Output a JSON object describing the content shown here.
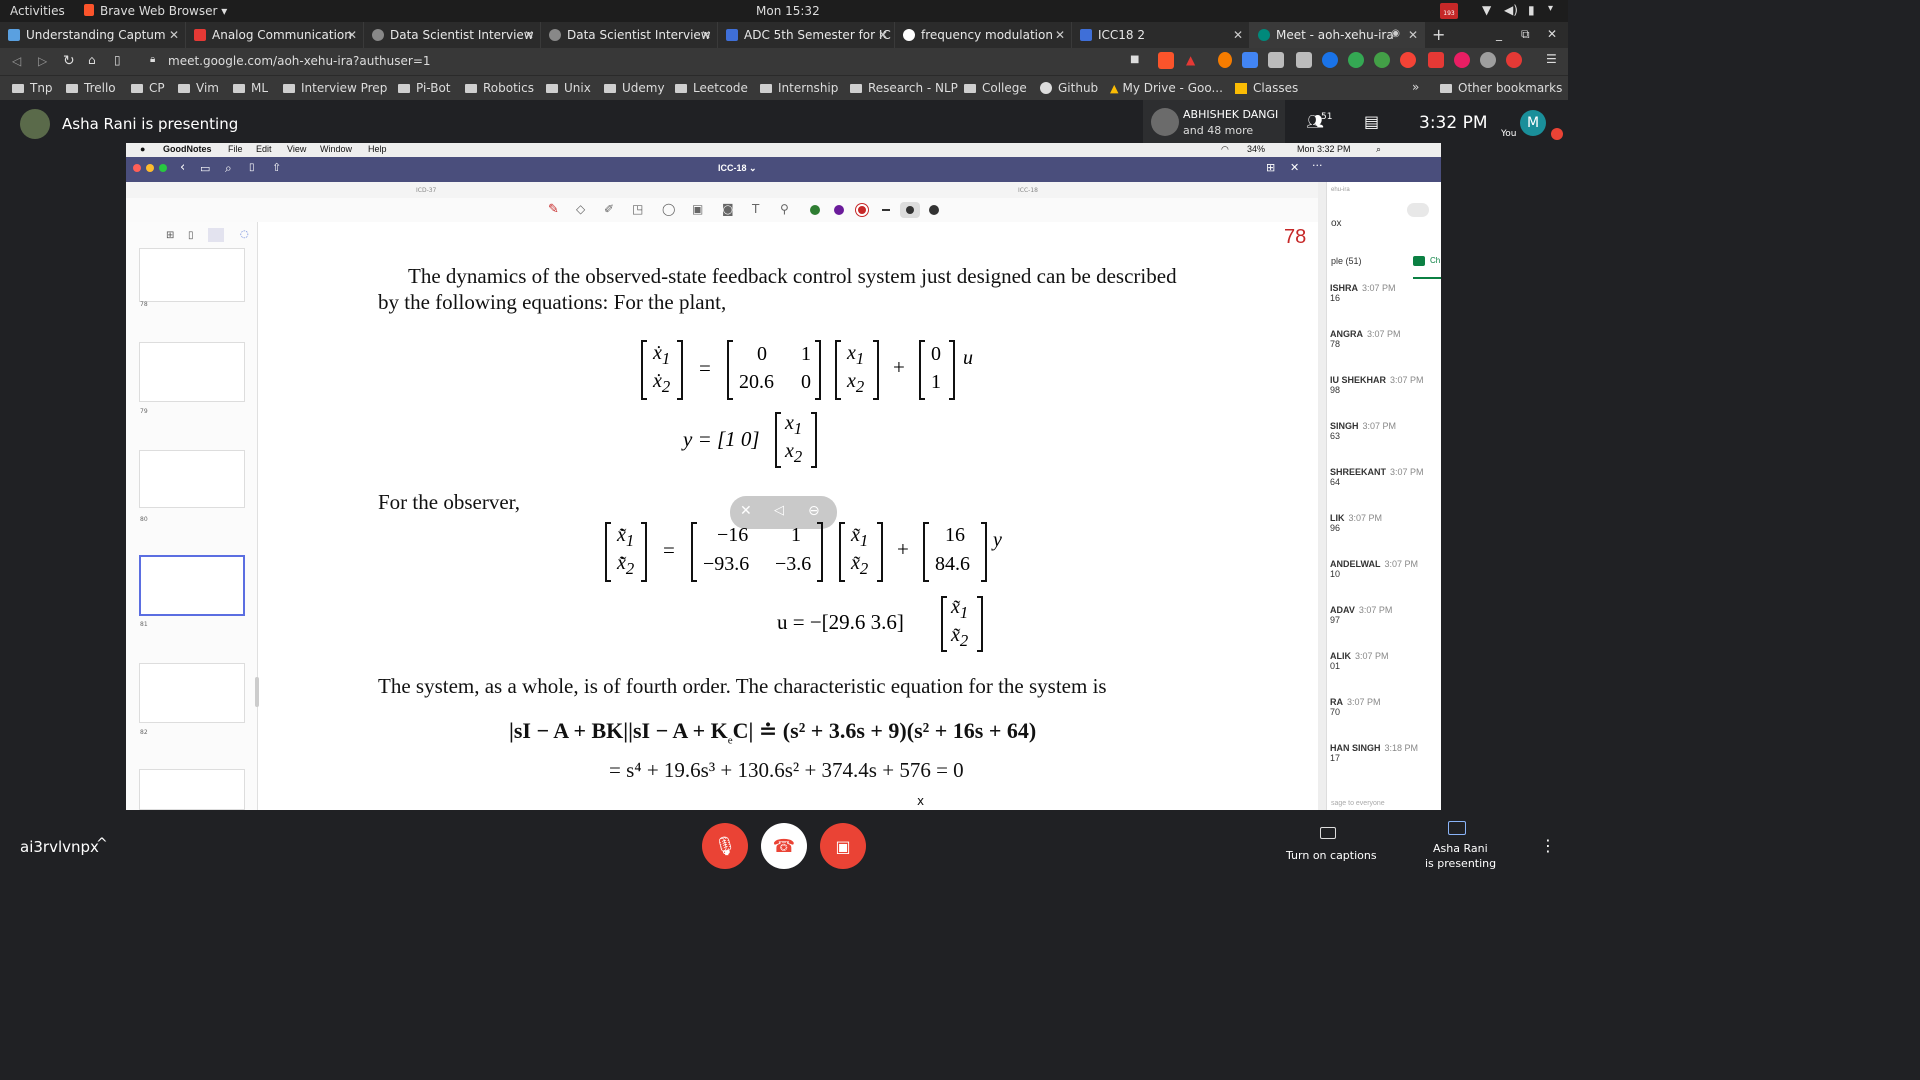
{
  "os_bar": {
    "activities": "Activities",
    "browser_menu": "Brave Web Browser ▾",
    "clock": "Mon 15:32",
    "notif_count": "193"
  },
  "tabs": [
    {
      "label": "Understanding Captum"
    },
    {
      "label": "Analog Communication"
    },
    {
      "label": "Data Scientist Interview"
    },
    {
      "label": "Data Scientist Interview"
    },
    {
      "label": "ADC 5th Semester for IC"
    },
    {
      "label": "frequency modulation"
    },
    {
      "label": "ICC18 2"
    },
    {
      "label": "Meet - aoh-xehu-ira"
    }
  ],
  "address": {
    "url": "meet.google.com/aoh-xehu-ira?authuser=1"
  },
  "bookmarks": [
    "Tnp",
    "Trello",
    "CP",
    "Vim",
    "ML",
    "Interview Prep",
    "Pi-Bot",
    "Robotics",
    "Unix",
    "Udemy",
    "Leetcode",
    "Internship",
    "Research - NLP",
    "College",
    "Github",
    "My Drive - Goo...",
    "Classes"
  ],
  "bookmarks_overflow": "»",
  "other_bookmarks": "Other bookmarks",
  "meet": {
    "presenting_text": "Asha Rani is presenting",
    "participant_name": "ABHISHEK DANGI",
    "participant_more": "and 48 more",
    "people_count": "51",
    "time": "3:32 PM",
    "avatar_letter": "M",
    "you_label": "You"
  },
  "mac_bar": {
    "app": "GoodNotes",
    "menus": [
      "File",
      "Edit",
      "View",
      "Window",
      "Help"
    ],
    "battery": "34%",
    "clock": "Mon 3:32 PM"
  },
  "goodnotes": {
    "doc_title": "ICC-18 ⌄",
    "tab_left": "ICD-37",
    "tab_right": "ICC-18",
    "page_number": "78"
  },
  "thumbnails": [
    {
      "num": "78"
    },
    {
      "num": "79"
    },
    {
      "num": "80"
    },
    {
      "num": "81"
    },
    {
      "num": "82"
    }
  ],
  "document": {
    "para1_line1": "The dynamics of the observed-state feedback control system just designed can be described",
    "para1_line2": "by the following equations: For the plant,",
    "observer_label": "For the observer,",
    "para3": "The system, as a whole, is of fourth order. The characteristic equation for the system is",
    "char_eq_line1": "|sI − A + BK||sI − A + K",
    "char_eq_line1_rest": "C| ≐ (s² + 3.6s + 9)(s² + 16s + 64)",
    "char_eq_line2": "= s⁴ + 19.6s³ + 130.6s² + 374.4s + 576 = 0",
    "plant_A": [
      "0",
      "1",
      "20.6",
      "0"
    ],
    "plant_B": [
      "0",
      "1"
    ],
    "output_eq": "y = [1   0]",
    "obs_A": [
      "−16",
      "1",
      "−93.6",
      "−3.6"
    ],
    "obs_K": [
      "16",
      "84.6"
    ],
    "control_eq": "u = −[29.6   3.6]"
  },
  "chat": {
    "header": "ox",
    "people_label": "ple (51)",
    "ch_label": "Ch",
    "items": [
      {
        "name": "ISHRA",
        "time": "3:07 PM",
        "msg": "16"
      },
      {
        "name": "ANGRA",
        "time": "3:07 PM",
        "msg": "78"
      },
      {
        "name": "IU SHEKHAR",
        "time": "3:07 PM",
        "msg": "98"
      },
      {
        "name": "SINGH",
        "time": "3:07 PM",
        "msg": "63"
      },
      {
        "name": "SHREEKANT",
        "time": "3:07 PM",
        "msg": "64"
      },
      {
        "name": "LIK",
        "time": "3:07 PM",
        "msg": "96"
      },
      {
        "name": "ANDELWAL",
        "time": "3:07 PM",
        "msg": "10"
      },
      {
        "name": "ADAV",
        "time": "3:07 PM",
        "msg": "97"
      },
      {
        "name": "ALIK",
        "time": "3:07 PM",
        "msg": "01"
      },
      {
        "name": "RA",
        "time": "3:07 PM",
        "msg": "70"
      },
      {
        "name": "HAN SINGH",
        "time": "3:18 PM",
        "msg": "17"
      }
    ],
    "input_placeholder": "sage to everyone",
    "side_title": "ehu-ira"
  },
  "bottom": {
    "meeting_code": "ai3rvlvnpx",
    "captions_label": "Turn on captions",
    "presenting_line1": "Asha Rani",
    "presenting_line2": "is presenting",
    "close_x": "x"
  },
  "colors": {
    "end_call": "#ea4335",
    "accent": "#1a73e8",
    "meet_bg": "#202124"
  }
}
